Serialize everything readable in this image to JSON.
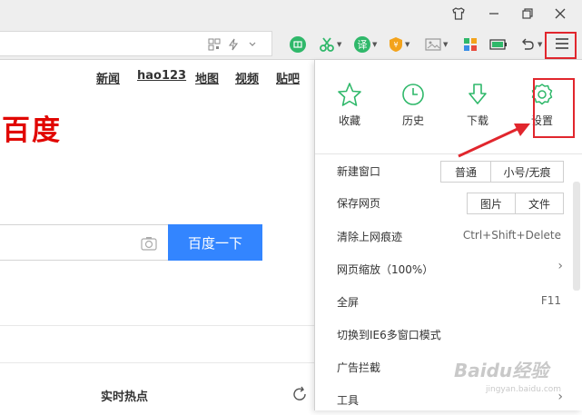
{
  "window": {
    "restore_glyph": "⧉",
    "minimize_glyph": "—",
    "skin_glyph": "👕",
    "close_glyph": "✕"
  },
  "toolbar": {
    "translate_label": "译",
    "menu_glyph": "☰"
  },
  "page": {
    "links": [
      "新闻",
      "hao123",
      "地图",
      "视频",
      "贴吧"
    ],
    "logo": "百度",
    "search_button": "百度一下",
    "hot_title": "实时热点"
  },
  "menu": {
    "quick": [
      "收藏",
      "历史",
      "下载",
      "设置"
    ],
    "items": [
      {
        "label": "新建窗口",
        "buttons": [
          "普通",
          "小号/无痕"
        ]
      },
      {
        "label": "保存网页",
        "buttons": [
          "图片",
          "文件"
        ]
      },
      {
        "label": "清除上网痕迹",
        "shortcut": "Ctrl+Shift+Delete"
      },
      {
        "label": "网页缩放（100%）",
        "arrow": "›"
      },
      {
        "label": "全屏",
        "shortcut": "F11"
      },
      {
        "label": "切换到IE6多窗口模式"
      },
      {
        "label": "广告拦截"
      },
      {
        "label": "工具",
        "arrow": "›"
      }
    ]
  },
  "watermark": {
    "brand": "Baidu经验",
    "url": "jingyan.baidu.com"
  },
  "colors": {
    "accent_green": "#2fb86a",
    "baidu_red": "#e10601",
    "search_blue": "#3385ff",
    "highlight_red": "#e1262d"
  }
}
